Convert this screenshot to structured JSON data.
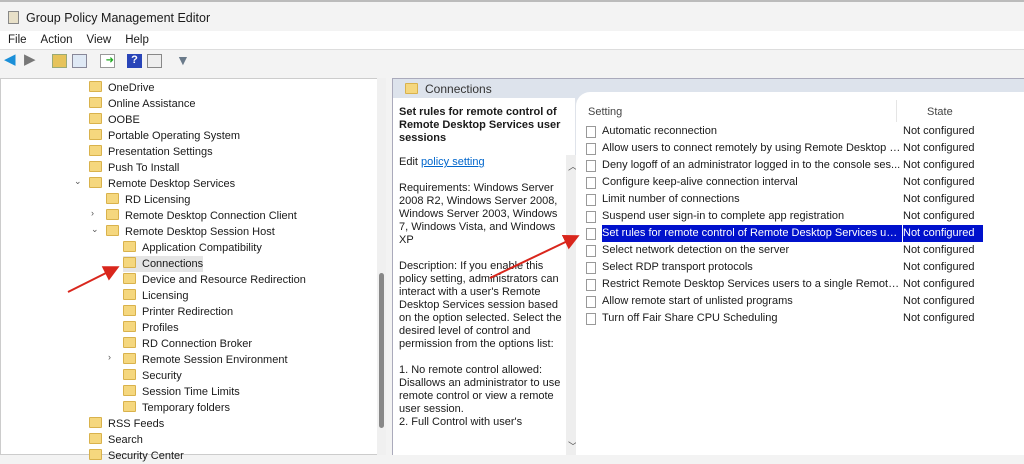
{
  "window": {
    "title": "Group Policy Management Editor"
  },
  "menu": [
    "File",
    "Action",
    "View",
    "Help"
  ],
  "tree": [
    {
      "label": "OneDrive",
      "level": 1
    },
    {
      "label": "Online Assistance",
      "level": 1
    },
    {
      "label": "OOBE",
      "level": 1
    },
    {
      "label": "Portable Operating System",
      "level": 1
    },
    {
      "label": "Presentation Settings",
      "level": 1
    },
    {
      "label": "Push To Install",
      "level": 1
    },
    {
      "label": "Remote Desktop Services",
      "level": 1,
      "expander": "expanded"
    },
    {
      "label": "RD Licensing",
      "level": 2
    },
    {
      "label": "Remote Desktop Connection Client",
      "level": 2,
      "expander": "collapsed"
    },
    {
      "label": "Remote Desktop Session Host",
      "level": 2,
      "expander": "expanded"
    },
    {
      "label": "Application Compatibility",
      "level": 3
    },
    {
      "label": "Connections",
      "level": 3,
      "selected": true
    },
    {
      "label": "Device and Resource Redirection",
      "level": 3
    },
    {
      "label": "Licensing",
      "level": 3
    },
    {
      "label": "Printer Redirection",
      "level": 3
    },
    {
      "label": "Profiles",
      "level": 3
    },
    {
      "label": "RD Connection Broker",
      "level": 3
    },
    {
      "label": "Remote Session Environment",
      "level": 3,
      "expander": "collapsed"
    },
    {
      "label": "Security",
      "level": 3
    },
    {
      "label": "Session Time Limits",
      "level": 3
    },
    {
      "label": "Temporary folders",
      "level": 3
    },
    {
      "label": "RSS Feeds",
      "level": 1
    },
    {
      "label": "Search",
      "level": 1
    },
    {
      "label": "Security Center",
      "level": 1
    }
  ],
  "panel": {
    "title": "Connections"
  },
  "description": {
    "title": "Set rules for remote control of Remote Desktop Services user sessions",
    "edit_prefix": "Edit ",
    "edit_link": "policy setting",
    "requirements": "Requirements: Windows Server 2008 R2, Windows Server 2008, Windows Server 2003, Windows 7, Windows Vista, and Windows XP",
    "description": "Description: If you enable this policy setting, administrators can interact with a user's Remote Desktop Services session based on the option selected. Select the desired level of control and permission from the options list:",
    "option1": "1. No remote control allowed: Disallows an administrator to use remote control or view a remote user session.",
    "option2": "2. Full Control with user's"
  },
  "list": {
    "columns": [
      "Setting",
      "State"
    ],
    "rows": [
      {
        "name": "Automatic reconnection",
        "state": "Not configured"
      },
      {
        "name": "Allow users to connect remotely by using Remote Desktop Se...",
        "state": "Not configured"
      },
      {
        "name": "Deny logoff of an administrator logged in to the console ses...",
        "state": "Not configured"
      },
      {
        "name": "Configure keep-alive connection interval",
        "state": "Not configured"
      },
      {
        "name": "Limit number of connections",
        "state": "Not configured"
      },
      {
        "name": "Suspend user sign-in to complete app registration",
        "state": "Not configured"
      },
      {
        "name": "Set rules for remote control of Remote Desktop Services user ...",
        "state": "Not configured",
        "selected": true
      },
      {
        "name": "Select network detection on the server",
        "state": "Not configured"
      },
      {
        "name": "Select RDP transport protocols",
        "state": "Not configured"
      },
      {
        "name": "Restrict Remote Desktop Services users to a single Remote De...",
        "state": "Not configured"
      },
      {
        "name": "Allow remote start of unlisted programs",
        "state": "Not configured"
      },
      {
        "name": "Turn off Fair Share CPU Scheduling",
        "state": "Not configured"
      }
    ]
  }
}
